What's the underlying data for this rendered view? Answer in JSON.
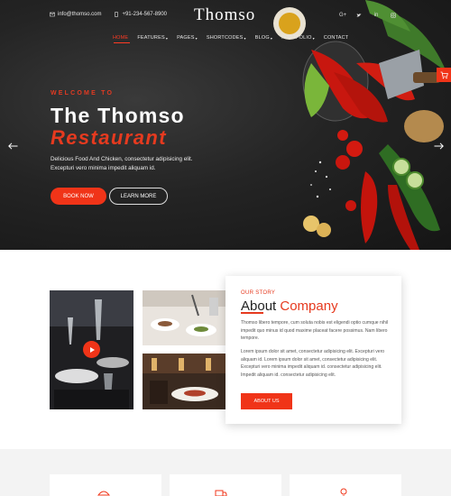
{
  "topbar": {
    "email": "info@thomso.com",
    "phone": "+91-234-567-8900"
  },
  "logo": {
    "text": "Thomso"
  },
  "socials": [
    "google-plus-icon",
    "twitter-icon",
    "linkedin-icon",
    "instagram-icon"
  ],
  "nav": {
    "items": [
      {
        "label": "HOME",
        "active": true
      },
      {
        "label": "FEATURES"
      },
      {
        "label": "PAGES"
      },
      {
        "label": "SHORTCODES"
      },
      {
        "label": "BLOG"
      },
      {
        "label": "PORTFOLIO"
      },
      {
        "label": "CONTACT"
      }
    ]
  },
  "hero": {
    "welcome": "WELCOME TO",
    "title_line1": "The Thomso",
    "title_line2": "Restaurant",
    "subtitle_line1": "Delicious Food And Chicken, consectetur adipisicing elit.",
    "subtitle_line2": "Excepturi vero minima impedit aliquam id.",
    "book_label": "BOOK NOW",
    "learn_label": "LEARN MORE"
  },
  "about": {
    "kicker": "OUR STORY",
    "title_dark": "About",
    "title_red": "Company",
    "para1": "Thomso libero tempore, cum soluta nobis est eligendi optio cumque nihil impedit quo minus id quod maxime placeat facere possimus. Nam libero tempore.",
    "para2": "Lorem ipsum dolor sit amet, consectetur adipisicing elit. Excepturi vero aliquam id. Lorem ipsum dolor sit amet, consectetur adipisicing elit. Excepturi vero minima impedit aliquam id. consectetur adipisicing elit. Impedit aliquam id. consectetur adipisicing elit.",
    "button_label": "ABOUT US"
  },
  "colors": {
    "accent": "#f03418",
    "dark_bg": "#1e1e1e"
  }
}
